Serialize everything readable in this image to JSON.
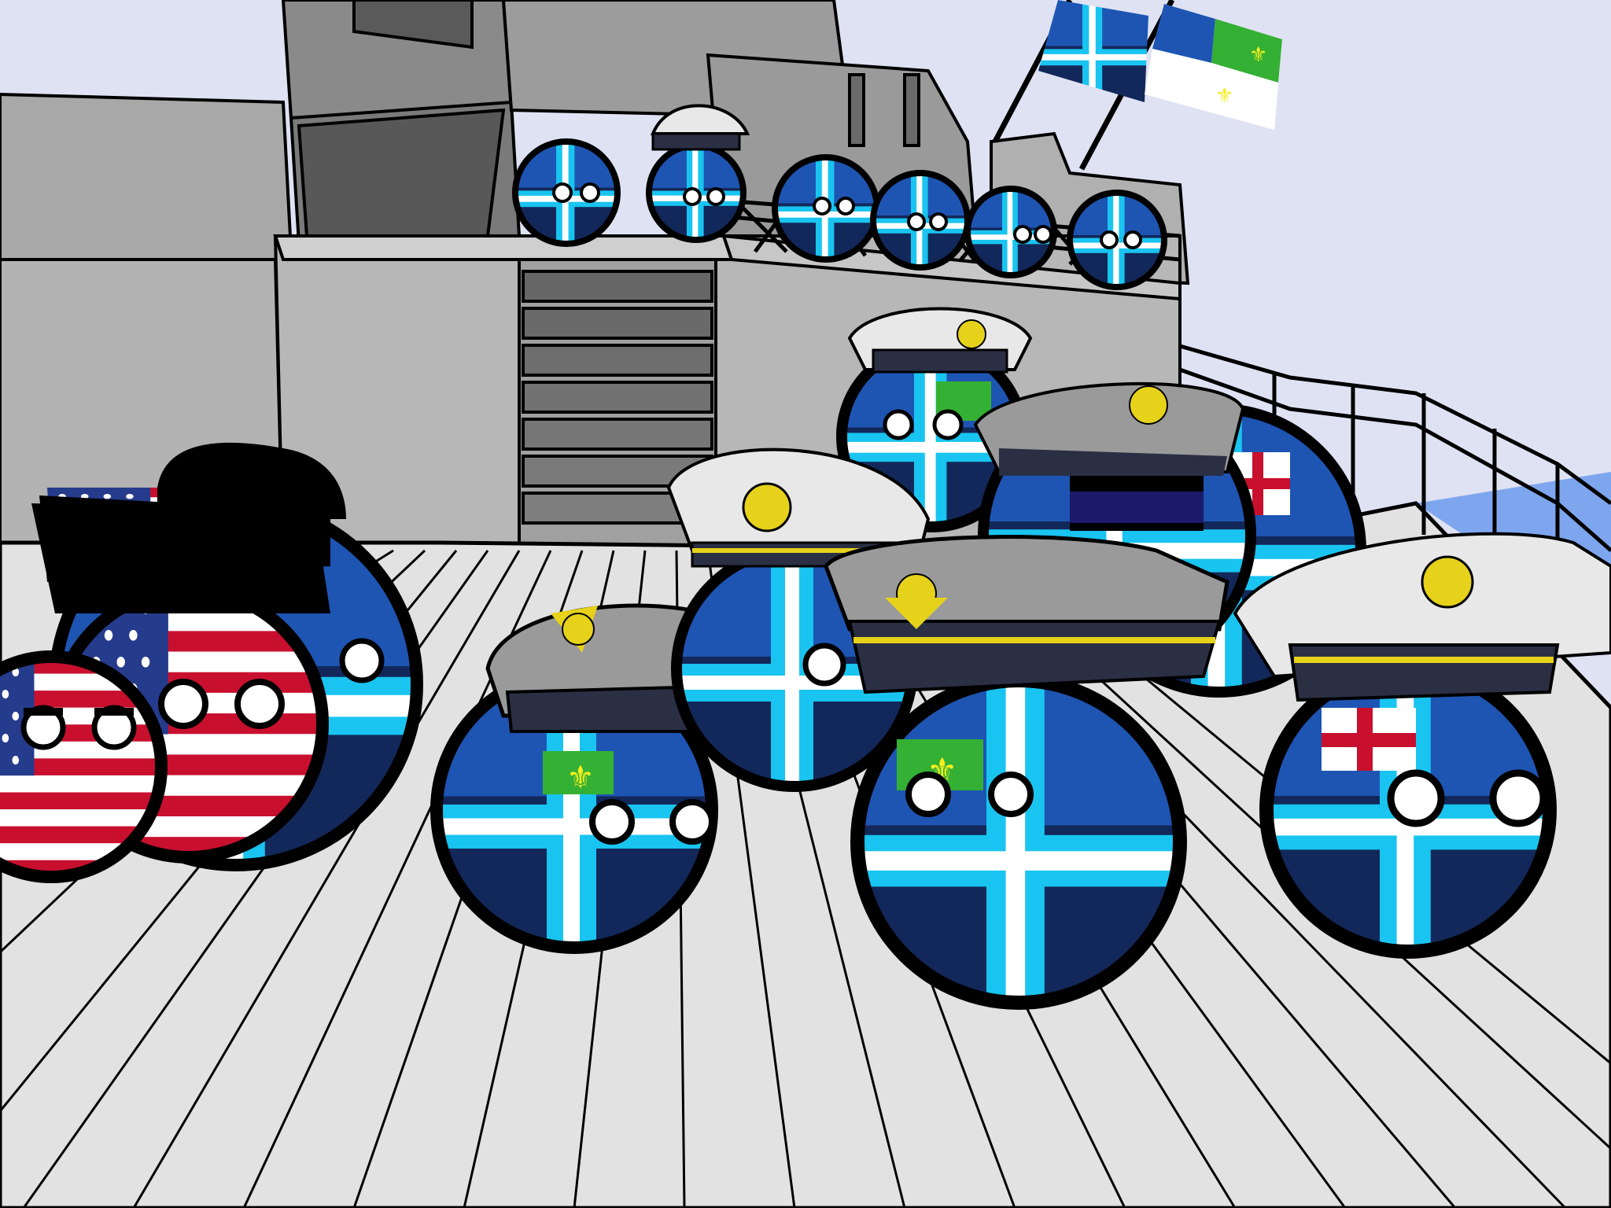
{
  "scene": {
    "description_visible_text": "",
    "colors": {
      "sky": "#dfe2f3",
      "ship_gray": "#a9a9a9",
      "ship_dark": "#5f5f5f",
      "deck": "#e0e0e0",
      "outline": "#000000",
      "flag_navy": "#12285a",
      "flag_blue": "#1e55b3",
      "flag_cyan": "#19c4f0",
      "flag_white": "#ffffff",
      "flag_green": "#34b034",
      "flag_yellow": "#f4ef1e",
      "usa_red": "#c8102e",
      "usa_blue": "#253b8c",
      "cap_gray": "#9a9a9a",
      "cap_white": "#e8e8e8",
      "cap_band": "#2a2f44",
      "cap_gold": "#e6d21a"
    },
    "characters": [
      {
        "name": "usa-ball-front",
        "flag": "usa"
      },
      {
        "name": "usa-ball-back",
        "flag": "usa"
      },
      {
        "name": "nordic-cross-ball-tophat",
        "flag": "nordic-cross"
      },
      {
        "name": "officer-ball-left",
        "flag": "nordic-cross-fleur"
      },
      {
        "name": "officer-ball-center",
        "flag": "nordic-cross-fleur"
      },
      {
        "name": "officer-ball-right",
        "flag": "nordic-cross-red-cross"
      },
      {
        "name": "officer-ball-mid-back",
        "flag": "nordic-cross-fleur"
      },
      {
        "name": "crew-ball-upper-deck",
        "flag": "nordic-cross"
      }
    ],
    "flags": [
      {
        "name": "nordic-cross-flag",
        "design": "nordic-cross"
      },
      {
        "name": "fleur-de-lis-flag",
        "design": "blue-white-green-fleur"
      }
    ]
  }
}
